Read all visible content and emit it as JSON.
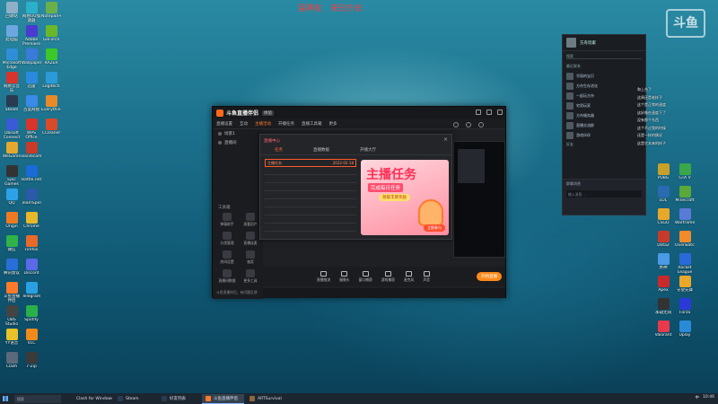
{
  "banner": {
    "left": "留神友",
    "right": "来日方长"
  },
  "colors": {
    "accent": "#ff7a2a",
    "live_button": "#ff8a1a",
    "banner_red": "#ff3b3b",
    "promo_red": "#ff2e55"
  },
  "desktop_icons": [
    {
      "label": "回收站",
      "color": "#8fb1c7"
    },
    {
      "label": "此电脑",
      "color": "#6da7e0"
    },
    {
      "label": "Microsoft Edge",
      "color": "#2e8fd8"
    },
    {
      "label": "网易云音乐",
      "color": "#d8342c"
    },
    {
      "label": "Steam",
      "color": "#2a3a52"
    },
    {
      "label": "Ubisoft Connect",
      "color": "#3a5ad8"
    },
    {
      "label": "WeGame",
      "color": "#e2a830"
    },
    {
      "label": "Epic Games",
      "color": "#333333"
    },
    {
      "label": "QQ",
      "color": "#2ea2e8"
    },
    {
      "label": "Origin",
      "color": "#f07a24"
    },
    {
      "label": "微信",
      "color": "#30b24a"
    },
    {
      "label": "腾讯会议",
      "color": "#2a6ed8"
    },
    {
      "label": "斗鱼直播伴侣",
      "color": "#ff7a2a"
    },
    {
      "label": "OBS Studio",
      "color": "#444444"
    },
    {
      "label": "YY语音",
      "color": "#e8c22a"
    },
    {
      "label": "Clash",
      "color": "#5a6a7a"
    },
    {
      "label": "网易UU加速器",
      "color": "#2ab0c8"
    },
    {
      "label": "Adobe Premiere",
      "color": "#4a3ad0"
    },
    {
      "label": "Wallpaper",
      "color": "#3a7ad8"
    },
    {
      "label": "迅雷",
      "color": "#2a8ae0"
    },
    {
      "label": "百度网盘",
      "color": "#3a8ae8"
    },
    {
      "label": "WPS Office",
      "color": "#d8342c"
    },
    {
      "label": "Bandicam",
      "color": "#c83a2a"
    },
    {
      "label": "Battle.net",
      "color": "#1a6ad8"
    },
    {
      "label": "TeamSpeak",
      "color": "#2a5aa8"
    },
    {
      "label": "Chrome",
      "color": "#e8b82a"
    },
    {
      "label": "Firefox",
      "color": "#e86a2a"
    },
    {
      "label": "Discord",
      "color": "#5a6ae8"
    },
    {
      "label": "Telegram",
      "color": "#2aa0e0"
    },
    {
      "label": "Spotify",
      "color": "#2ab04a"
    },
    {
      "label": "VLC",
      "color": "#f08a1a"
    },
    {
      "label": "7-Zip",
      "color": "#3a3a3a"
    },
    {
      "label": "Notepad++",
      "color": "#6ab04a"
    },
    {
      "label": "GeForce",
      "color": "#6ab82a"
    },
    {
      "label": "RAZER",
      "color": "#3ac82a"
    },
    {
      "label": "Logitech",
      "color": "#2a9ad8"
    },
    {
      "label": "Everything",
      "color": "#e88a2a"
    },
    {
      "label": "CCleaner",
      "color": "#d84a2a"
    }
  ],
  "right_icons": [
    {
      "label": "PUBG",
      "color": "#c8a02a"
    },
    {
      "label": "LOL",
      "color": "#2a6ab0"
    },
    {
      "label": "CSGO",
      "color": "#e8a82a"
    },
    {
      "label": "Dota2",
      "color": "#c83a2a"
    },
    {
      "label": "原神",
      "color": "#4a9ae8"
    },
    {
      "label": "Apex",
      "color": "#c82a2a"
    },
    {
      "label": "永劫无间",
      "color": "#333"
    },
    {
      "label": "Valorant",
      "color": "#e83a4a"
    },
    {
      "label": "GTA V",
      "color": "#3aa84a"
    },
    {
      "label": "Minecraft",
      "color": "#5aa83a"
    },
    {
      "label": "Warframe",
      "color": "#5a7ad8"
    },
    {
      "label": "Overwatch",
      "color": "#f08a2a"
    },
    {
      "label": "Rocket League",
      "color": "#2a6ad8"
    },
    {
      "label": "守望先锋",
      "color": "#e8a82a"
    },
    {
      "label": "Forza",
      "color": "#2a3ad8"
    },
    {
      "label": "Uplay",
      "color": "#2a8ad8"
    }
  ],
  "app": {
    "title": "斗鱼直播伴侣",
    "version_badge": "体验",
    "tabs": [
      "直播设置",
      "互动",
      "主播活动",
      "开播任务",
      "直播工具箱",
      "更多"
    ],
    "side_items": [
      "场景1",
      "直播间"
    ],
    "tools_header": "工具箱",
    "tools": [
      {
        "label": "弹幕助手"
      },
      {
        "label": "观看用户"
      },
      {
        "label": "分类管理"
      },
      {
        "label": "直播连麦"
      },
      {
        "label": "房间设置"
      },
      {
        "label": "抽奖"
      },
      {
        "label": "直播间数据"
      },
      {
        "label": "更多工具"
      }
    ],
    "footer": "斗鱼直播伴侣，有问题反馈",
    "bottom_actions": [
      "直播推流",
      "摄像头",
      "窗口捕获",
      "游戏捕获",
      "麦克风",
      "声音"
    ],
    "start_live_label": "开始直播"
  },
  "dialog": {
    "title": "直播中心",
    "close": "×",
    "tabs": [
      "任务",
      "直播数据",
      "开播大厅"
    ],
    "active_tab": 0,
    "rows": [
      {
        "name": "主播任务",
        "date": "2022-02-18"
      },
      {
        "name": "",
        "date": ""
      },
      {
        "name": "",
        "date": ""
      },
      {
        "name": "",
        "date": ""
      },
      {
        "name": "",
        "date": ""
      },
      {
        "name": "",
        "date": ""
      },
      {
        "name": "",
        "date": ""
      },
      {
        "name": "",
        "date": ""
      },
      {
        "name": "",
        "date": ""
      }
    ],
    "promo": {
      "headline": "主播任务",
      "subline": "完成每日任务",
      "button": "领取丰厚奖励",
      "cta": "立即参与"
    }
  },
  "chat": {
    "user": "方舟玩家",
    "search_placeholder": "搜索",
    "section_recent": "最近联系",
    "contacts": [
      "华丽的宝贝",
      "方舟生存进化",
      "一起玩方舟",
      "宅男玩家",
      "方舟服务器",
      "直播交流群",
      "游戏伙伴"
    ],
    "section_friends": "好友",
    "footer_header": "群聊消息",
    "footer_input": "输入消息..."
  },
  "overlay_lines": [
    "和上台了",
    "这周还是老样子",
    "这个是正常的速度",
    "这好像在速度下了",
    "没有那个东西",
    "这个不过我的时候",
    "还是一样的情况",
    "这是它本来的样子"
  ],
  "corner_logo": "斗鱼",
  "taskbar": {
    "search_placeholder": "搜索",
    "items": [
      {
        "label": "Clash for Windows",
        "color": "#5a6a7a",
        "active": false
      },
      {
        "label": "Steam",
        "color": "#2a3a52",
        "active": false
      },
      {
        "label": "好友列表",
        "color": "#2a3a52",
        "active": false
      },
      {
        "label": "斗鱼直播伴侣",
        "color": "#ff7a2a",
        "active": true
      },
      {
        "label": "ARTSurvival",
        "color": "#8a6a3a",
        "active": false
      }
    ],
    "time": "10:46",
    "lang": "中"
  }
}
